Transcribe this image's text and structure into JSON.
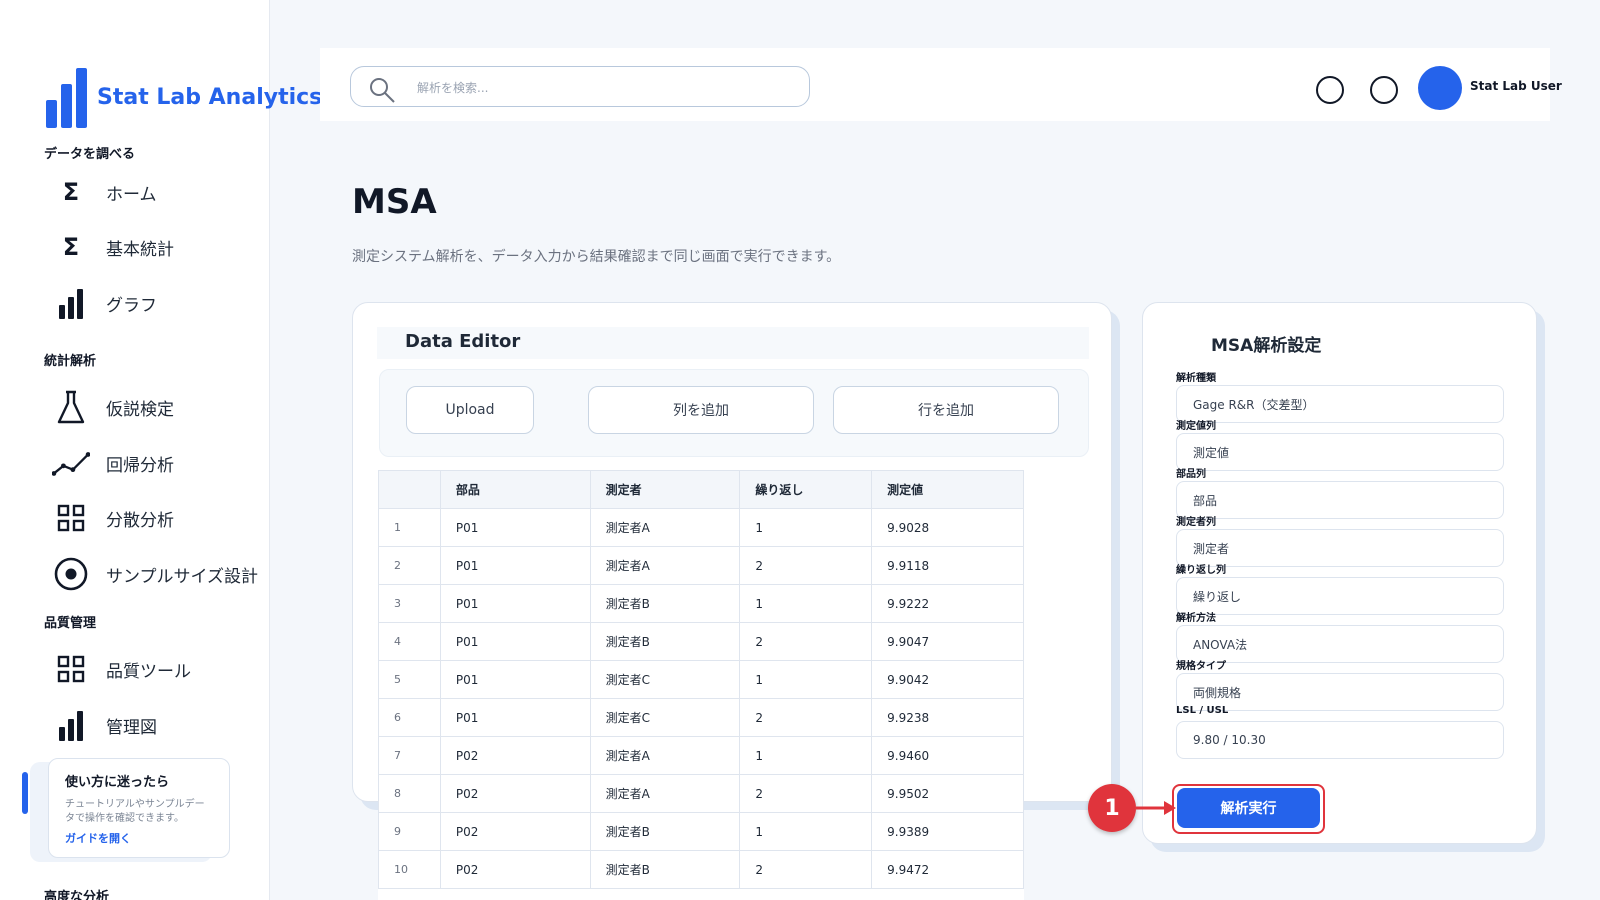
{
  "brand": {
    "name": "Stat Lab Analytics"
  },
  "sidebar": {
    "sections": [
      {
        "title": "データを調べる"
      },
      {
        "title": "統計解析"
      },
      {
        "title": "品質管理"
      },
      {
        "title": "高度な分析"
      }
    ],
    "items": [
      {
        "label": "ホーム",
        "icon": "sigma-icon"
      },
      {
        "label": "基本統計",
        "icon": "sigma-icon"
      },
      {
        "label": "グラフ",
        "icon": "bar-chart-icon"
      },
      {
        "label": "仮説検定",
        "icon": "flask-icon"
      },
      {
        "label": "回帰分析",
        "icon": "trend-line-icon"
      },
      {
        "label": "分散分析",
        "icon": "grid-icon"
      },
      {
        "label": "サンプルサイズ設計",
        "icon": "target-icon"
      },
      {
        "label": "品質ツール",
        "icon": "grid-icon"
      },
      {
        "label": "管理図",
        "icon": "bar-chart-icon"
      }
    ],
    "guide": {
      "title": "使い方に迷ったら",
      "description": "チュートリアルやサンプルデータで操作を確認できます。",
      "link": "ガイドを開く"
    }
  },
  "topbar": {
    "search_placeholder": "解析を検索...",
    "user_name": "Stat Lab User"
  },
  "page": {
    "title": "MSA",
    "description": "測定システム解析を、データ入力から結果確認まで同じ画面で実行できます。"
  },
  "editor": {
    "title": "Data Editor",
    "buttons": {
      "upload": "Upload",
      "add_column": "列を追加",
      "add_row": "行を追加"
    },
    "columns": [
      "",
      "部品",
      "測定者",
      "繰り返し",
      "測定値"
    ],
    "rows": [
      [
        "1",
        "P01",
        "測定者A",
        "1",
        "9.9028"
      ],
      [
        "2",
        "P01",
        "測定者A",
        "2",
        "9.9118"
      ],
      [
        "3",
        "P01",
        "測定者B",
        "1",
        "9.9222"
      ],
      [
        "4",
        "P01",
        "測定者B",
        "2",
        "9.9047"
      ],
      [
        "5",
        "P01",
        "測定者C",
        "1",
        "9.9042"
      ],
      [
        "6",
        "P01",
        "測定者C",
        "2",
        "9.9238"
      ],
      [
        "7",
        "P02",
        "測定者A",
        "1",
        "9.9460"
      ],
      [
        "8",
        "P02",
        "測定者A",
        "2",
        "9.9502"
      ],
      [
        "9",
        "P02",
        "測定者B",
        "1",
        "9.9389"
      ],
      [
        "10",
        "P02",
        "測定者B",
        "2",
        "9.9472"
      ]
    ]
  },
  "settings": {
    "title": "MSA解析設定",
    "fields": [
      {
        "label": "解析種類",
        "value": "Gage R&R（交差型）"
      },
      {
        "label": "測定値列",
        "value": "測定値"
      },
      {
        "label": "部品列",
        "value": "部品"
      },
      {
        "label": "測定者列",
        "value": "測定者"
      },
      {
        "label": "繰り返し列",
        "value": "繰り返し"
      },
      {
        "label": "解析方法",
        "value": "ANOVA法"
      },
      {
        "label": "規格タイプ",
        "value": "両側規格"
      },
      {
        "label": "LSL / USL",
        "value": "9.80 / 10.30"
      }
    ],
    "run_label": "解析実行"
  },
  "annotation": {
    "step": "1"
  },
  "colors": {
    "accent": "#2563eb",
    "highlight": "#e0343c"
  }
}
